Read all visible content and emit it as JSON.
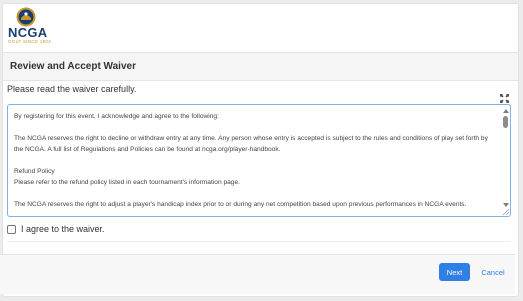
{
  "brand": {
    "name": "NCGA",
    "tagline": "GOLF SINCE 1903",
    "primary_color": "#1a3e73",
    "accent_color": "#c9962a"
  },
  "header": {
    "title": "Review and Accept Waiver"
  },
  "main": {
    "instructions": "Please read the waiver carefully.",
    "expand_icon": "expand-icon",
    "waiver": {
      "intro": "By registering for this event, I acknowledge and agree to the following:",
      "para1": "The NCGA reserves the right to decline or withdraw entry at any time. Any person whose entry is accepted is subject to the rules and conditions of play set forth by the NCGA. A full list of Regulations and Policies can be found at ncga.org/player-handbook.",
      "refund_heading": "Refund Policy",
      "refund_text": "Please refer to the refund policy listed in each tournament's information page.",
      "para2": "The NCGA reserves the right to adjust a player's handicap index prior to or during any net competition based upon previous performances in NCGA events."
    },
    "agree_label": "I agree to the waiver.",
    "agree_checked": false
  },
  "footer": {
    "next_label": "Next",
    "cancel_label": "Cancel"
  },
  "colors": {
    "button_primary": "#2f7fe6",
    "focus_border": "#7fb2e2"
  }
}
